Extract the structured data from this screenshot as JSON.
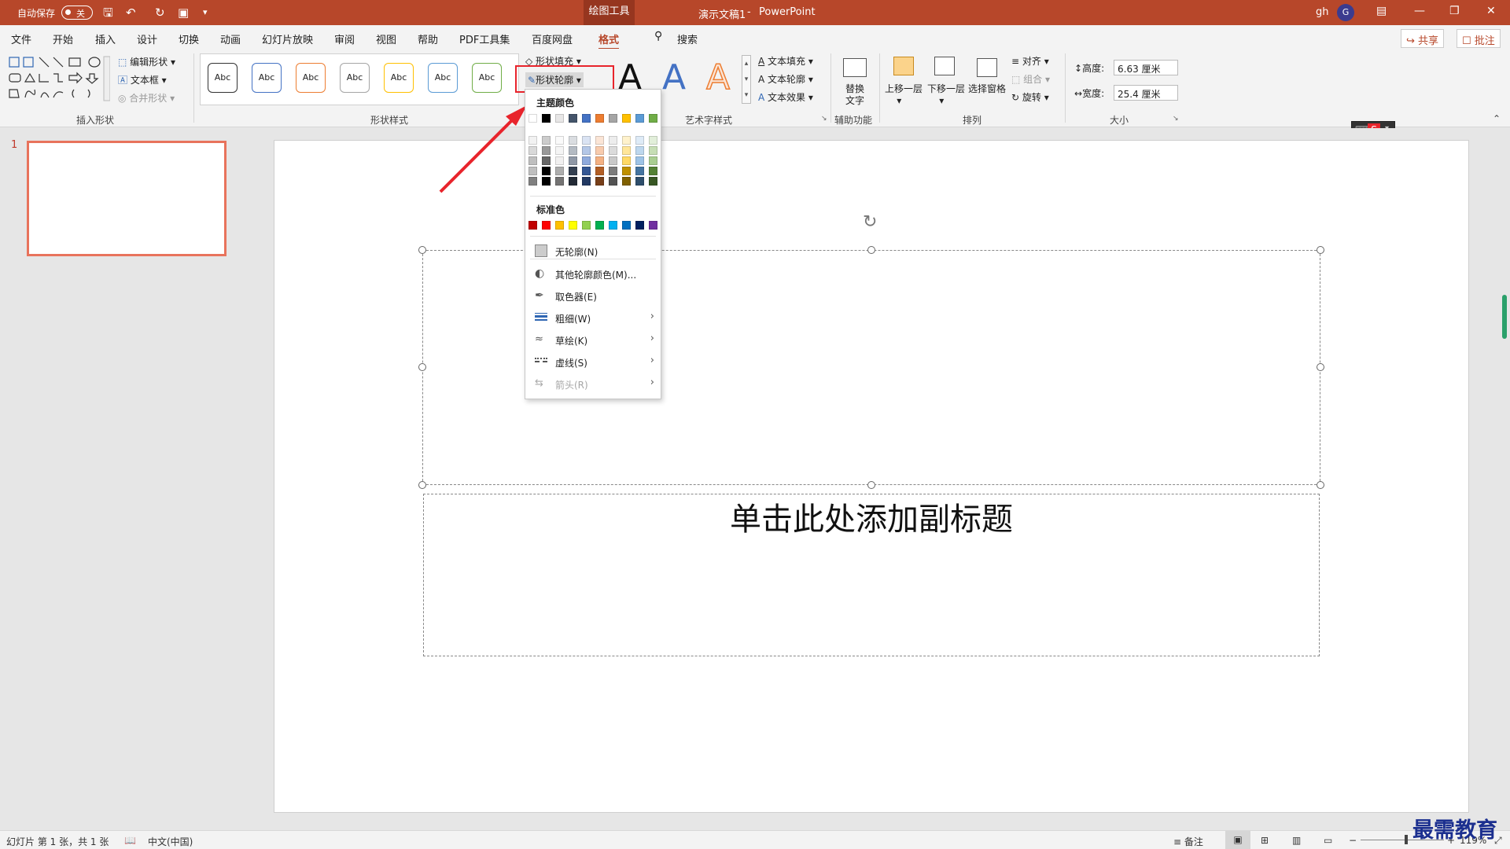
{
  "titlebar": {
    "autosave": "自动保存",
    "autosave_state": "关",
    "context_tab": "绘图工具",
    "doc": "演示文稿1",
    "sep": "-",
    "app": "PowerPoint",
    "user": "gh",
    "avatar": "G"
  },
  "tabs": [
    "文件",
    "开始",
    "插入",
    "设计",
    "切换",
    "动画",
    "幻灯片放映",
    "审阅",
    "视图",
    "帮助",
    "PDF工具集",
    "百度网盘",
    "格式"
  ],
  "active_tab": "格式",
  "search": "搜索",
  "share": "共享",
  "comments": "批注",
  "ribbon": {
    "insert_shapes": {
      "edit_shape": "编辑形状",
      "text_box": "文本框",
      "merge_shapes": "合并形状",
      "label": "插入形状"
    },
    "shape_styles": {
      "abc": "Abc",
      "colors": [
        "#333333",
        "#4472c4",
        "#ed7d31",
        "#a5a5a5",
        "#ffc000",
        "#5b9bd5",
        "#70ad47"
      ],
      "fill": "形状填充",
      "outline": "形状轮廓",
      "label": "形状样式"
    },
    "wordart": {
      "letter": "A",
      "text_fill": "文本填充",
      "text_outline": "文本轮廓",
      "text_effects": "文本效果",
      "label": "艺术字样式"
    },
    "accessibility": {
      "alt_text_1": "替换",
      "alt_text_2": "文字",
      "label": "辅助功能"
    },
    "arrange": {
      "bring_forward": "上移一层",
      "send_backward": "下移一层",
      "selection_pane": "选择窗格",
      "align": "对齐",
      "group": "组合",
      "rotate": "旋转",
      "label": "排列"
    },
    "size": {
      "height_label": "高度:",
      "height": "6.63 厘米",
      "width_label": "宽度:",
      "width": "25.4 厘米",
      "label": "大小"
    }
  },
  "menu": {
    "theme_colors": "主题颜色",
    "theme_top": [
      "#ffffff",
      "#000000",
      "#e7e6e6",
      "#44546a",
      "#4472c4",
      "#ed7d31",
      "#a5a5a5",
      "#ffc000",
      "#5b9bd5",
      "#70ad47"
    ],
    "standard_colors": "标准色",
    "standard": [
      "#c00000",
      "#ff0000",
      "#ffc000",
      "#ffff00",
      "#92d050",
      "#00b050",
      "#00b0f0",
      "#0070c0",
      "#002060",
      "#7030a0"
    ],
    "items": [
      {
        "label": "无轮廓(N)",
        "icon": "no-outline-icon",
        "arrow": false,
        "disabled": false
      },
      {
        "label": "其他轮廓颜色(M)...",
        "icon": "palette-icon",
        "arrow": false,
        "disabled": false
      },
      {
        "label": "取色器(E)",
        "icon": "eyedropper-icon",
        "arrow": false,
        "disabled": false
      },
      {
        "label": "粗细(W)",
        "icon": "line-weight-icon",
        "arrow": true,
        "disabled": false
      },
      {
        "label": "草绘(K)",
        "icon": "sketch-icon",
        "arrow": true,
        "disabled": false
      },
      {
        "label": "虚线(S)",
        "icon": "dashes-icon",
        "arrow": true,
        "disabled": false
      },
      {
        "label": "箭头(R)",
        "icon": "arrows-icon",
        "arrow": true,
        "disabled": true
      }
    ]
  },
  "slides": {
    "number": "1"
  },
  "slide": {
    "subtitle": "单击此处添加副标题"
  },
  "status": {
    "slide": "幻灯片 第 1 张，共 1 张",
    "lang": "中文(中国)",
    "notes": "备注",
    "zoom": "119%",
    "minus": "−",
    "plus": "+"
  },
  "watermark": "最需教育"
}
